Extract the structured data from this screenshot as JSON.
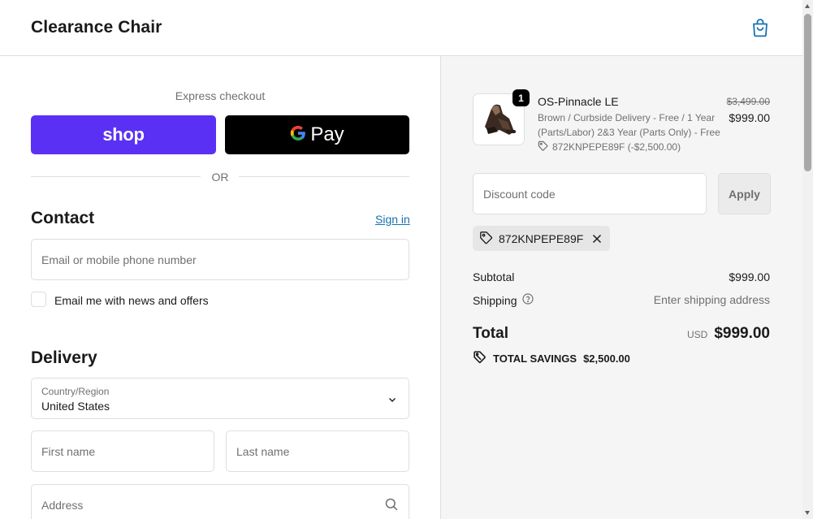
{
  "header": {
    "store_title": "Clearance Chair",
    "bag_icon": "shopping-bag-icon"
  },
  "express": {
    "label": "Express checkout",
    "shop_label": "shop",
    "gpay_label": "Pay",
    "or_label": "OR",
    "shop_color": "#5a31f4",
    "gpay_color": "#000000"
  },
  "contact": {
    "title": "Contact",
    "sign_in": "Sign in",
    "email_placeholder": "Email or mobile phone number",
    "news_label": "Email me with news and offers",
    "news_checked": false
  },
  "delivery": {
    "title": "Delivery",
    "country_label": "Country/Region",
    "country_value": "United States",
    "first_name_placeholder": "First name",
    "last_name_placeholder": "Last name",
    "address_placeholder": "Address"
  },
  "order": {
    "product": {
      "quantity": "1",
      "name": "OS-Pinnacle LE",
      "variant": "Brown / Curbside Delivery - Free / 1 Year (Parts/Labor) 2&3 Year (Parts Only) - Free",
      "discount": "872KNPEPE89F (-$2,500.00)",
      "price_original": "$3,499.00",
      "price": "$999.00"
    },
    "discount_placeholder": "Discount code",
    "apply_label": "Apply",
    "applied_code": "872KNPEPE89F",
    "subtotal_label": "Subtotal",
    "subtotal_value": "$999.00",
    "shipping_label": "Shipping",
    "shipping_value": "Enter shipping address",
    "total_label": "Total",
    "total_currency": "USD",
    "total_value": "$999.00",
    "savings_label": "TOTAL SAVINGS",
    "savings_value": "$2,500.00"
  },
  "colors": {
    "link": "#1773b0",
    "summary_bg": "#f5f5f5",
    "border": "#dedede"
  }
}
